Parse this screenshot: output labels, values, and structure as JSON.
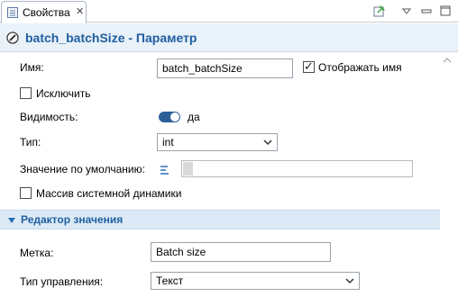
{
  "tab": {
    "label": "Свойства",
    "close": "✕"
  },
  "title": {
    "text": "batch_batchSize - Параметр"
  },
  "form": {
    "name_label": "Имя:",
    "name_value": "batch_batchSize",
    "show_name_label": "Отображать имя",
    "show_name_checked": true,
    "exclude_label": "Исключить",
    "exclude_checked": false,
    "visibility_label": "Видимость:",
    "visibility_value": "да",
    "type_label": "Тип:",
    "type_value": "int",
    "default_label": "Значение по умолчанию:",
    "default_value": "",
    "sysdyn_array_label": "Массив системной динамики",
    "sysdyn_array_checked": false
  },
  "value_editor": {
    "section_title": "Редактор значения",
    "label_label": "Метка:",
    "label_value": "Batch size",
    "control_type_label": "Тип управления:",
    "control_type_value": "Текст"
  },
  "colors": {
    "accent": "#1e5f9f",
    "header_bg": "#e9f1f9",
    "section_bg": "#dceaf7",
    "toggle": "#2d5f98"
  }
}
